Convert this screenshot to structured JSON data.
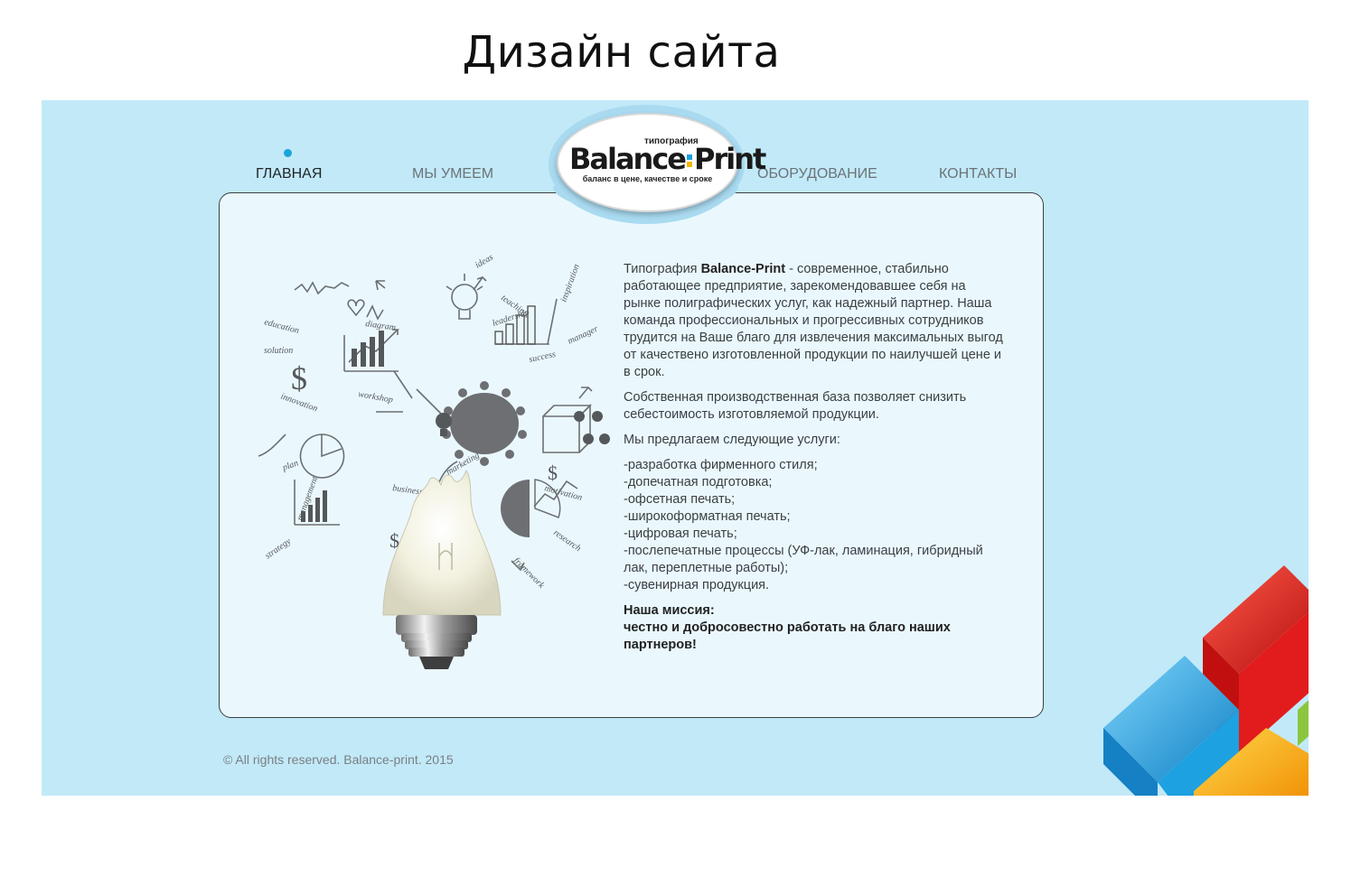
{
  "slide": {
    "title": "Дизайн сайта"
  },
  "nav": {
    "items": [
      {
        "label": "ГЛАВНАЯ",
        "active": true
      },
      {
        "label": "МЫ УМЕЕМ",
        "active": false
      },
      {
        "label": "ОБОРУДОВАНИЕ",
        "active": false
      },
      {
        "label": "КОНТАКТЫ",
        "active": false
      }
    ]
  },
  "logo": {
    "small": "типография",
    "brand_left": "Balance",
    "brand_right": "Print",
    "tagline": "баланс в цене, качестве и сроке"
  },
  "content": {
    "intro_prefix": "Типография ",
    "intro_brand": "Balance-Print",
    "intro_rest": " - современное, стабильно работающее предприятие, зарекомендовавшее себя на рынке полиграфических услуг, как надежный партнер. Наша команда профессиональных и прогрессивных сотрудников трудится на Ваше благо для извлечения максимальных выгод от качествено изготовленной продукции по наилучшей цене и в срок.",
    "base": "Собственная производственная база позволяет снизить себестоимость изготовляемой продукции.",
    "offer": "Мы предлагаем следующие услуги:",
    "services": [
      "-разработка фирменного стиля;",
      "-допечатная подготовка;",
      "-офсетная печать;",
      "-широкоформатная печать;",
      "-цифровая печать;",
      "-послепечатные процессы (УФ-лак, ламинация, гибридный лак, переплетные работы);",
      "-сувенирная продукция."
    ],
    "mission_title": "Наша миссия:",
    "mission_text": "честно и добросовестно работать на благо наших партнеров!"
  },
  "illustration_words": [
    "ideas",
    "teaching",
    "education",
    "diagram",
    "leadership",
    "solution",
    "innovation",
    "workshop",
    "success",
    "manager",
    "plan",
    "marketing",
    "business",
    "motivation",
    "research",
    "strategy",
    "framework",
    "management",
    "inspiration"
  ],
  "footer": {
    "copyright": "© All rights reserved. Balance-print. 2015"
  },
  "colors": {
    "site_bg": "#c2e9f8",
    "panel_bg": "#eaf8fe",
    "accent": "#1aa4d9",
    "cube_red": "#d81818",
    "cube_blue": "#1da1e0",
    "cube_yellow": "#f7b500",
    "cube_green": "#8cc63f"
  },
  "icons": [
    "lightbulb-icon",
    "dollar-icon",
    "bar-chart-icon",
    "pie-chart-icon",
    "people-circle-icon",
    "arrow-icon",
    "cubes-decoration"
  ]
}
